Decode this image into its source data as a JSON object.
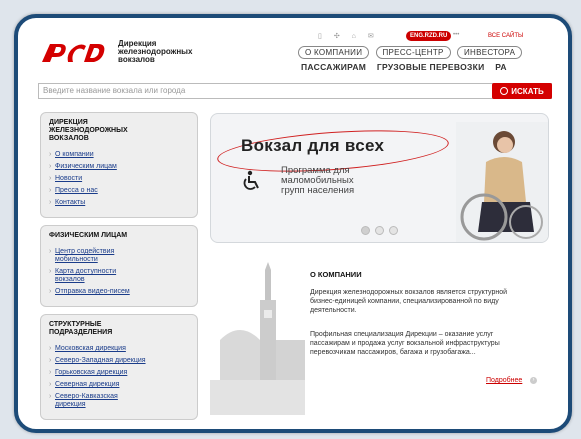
{
  "header": {
    "logo_lines": [
      "Дирекция",
      "железнодорожных",
      "вокзалов"
    ],
    "lang_badge": "ENG.RZD.RU",
    "separator_dots": "•••",
    "all_sites": "ВСЕ САЙТЫ",
    "nav_top": [
      "О КОМПАНИИ",
      "ПРЕСС-ЦЕНТР",
      "ИНВЕСТОРА"
    ],
    "nav_main": [
      "ПАССАЖИРАМ",
      "ГРУЗОВЫЕ ПЕРЕВОЗКИ",
      "РА"
    ]
  },
  "search": {
    "placeholder": "Введите название вокзала или города",
    "button_label": "ИСКАТЬ"
  },
  "sidebar": {
    "box1": {
      "title_lines": [
        "ДИРЕКЦИЯ",
        "ЖЕЛЕЗНОДОРОЖНЫХ",
        "ВОКЗАЛОВ"
      ],
      "items": [
        "О компании",
        "Физическим лицам",
        "Новости",
        "Пресса о нас",
        "Контакты"
      ]
    },
    "box2": {
      "title": "ФИЗИЧЕСКИМ ЛИЦАМ",
      "items": [
        [
          "Центр содействия",
          "мобильности"
        ],
        [
          "Карта доступности",
          "вокзалов"
        ],
        [
          "Отправка видео-писем"
        ]
      ]
    },
    "box3": {
      "title_lines": [
        "СТРУКТУРНЫЕ",
        "ПОДРАЗДЕЛЕНИЯ"
      ],
      "items": [
        [
          "Московская дирекция"
        ],
        [
          "Северо-Западная дирекция"
        ],
        [
          "Горьковская дирекция"
        ],
        [
          "Северная дирекция"
        ],
        [
          "Северо-Кавказская",
          "дирекция"
        ]
      ]
    }
  },
  "banner": {
    "title": "Вокзал для всех",
    "subtitle_lines": [
      "Программа для",
      "маломобильных",
      "групп населения"
    ],
    "slide_count": 3,
    "active_slide": 1
  },
  "about": {
    "title": "О КОМПАНИИ",
    "paragraph1": "Дирекция железнодорожных вокзалов является структурной бизнес-единицей компании, специализированной по виду деятельности.",
    "paragraph2": "Профильная специализация Дирекции – оказание услуг пассажирам и продажа услуг вокзальной инфраструктуры перевозчикам пассажиров, багажа и грузобагажа...",
    "more_link": "Подробнее"
  },
  "colors": {
    "brand_red": "#d40000",
    "frame_blue": "#1d4b78",
    "link_blue": "#1a3c8a"
  }
}
